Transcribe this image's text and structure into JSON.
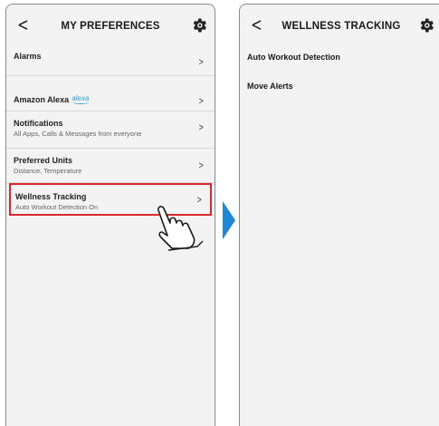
{
  "left": {
    "title": "MY PREFERENCES",
    "items": [
      {
        "label": "Alarms",
        "sub": ""
      },
      {
        "label": "Amazon Alexa",
        "sub": "",
        "logo_text": "alexa"
      },
      {
        "label": "Notifications",
        "sub": "All Apps, Calls & Messages from everyone"
      },
      {
        "label": "Preferred Units",
        "sub": "Distance, Temperature"
      },
      {
        "label": "Wellness Tracking",
        "sub": "Auto Workout Detection On"
      }
    ]
  },
  "right": {
    "title": "WELLNESS TRACKING",
    "items": [
      {
        "label": "Auto Workout Detection"
      },
      {
        "label": "Move Alerts"
      }
    ]
  },
  "glyphs": {
    "back": "<",
    "chevron": ">"
  },
  "colors": {
    "highlight": "#d9282f",
    "arrow": "#1e88d6",
    "alexa": "#2d9fd6",
    "screen": "#f3f3f3"
  },
  "icons": {
    "settings": "gear-icon",
    "pointer": "pointing-hand-icon",
    "transition": "right-triangle-arrow-icon"
  }
}
